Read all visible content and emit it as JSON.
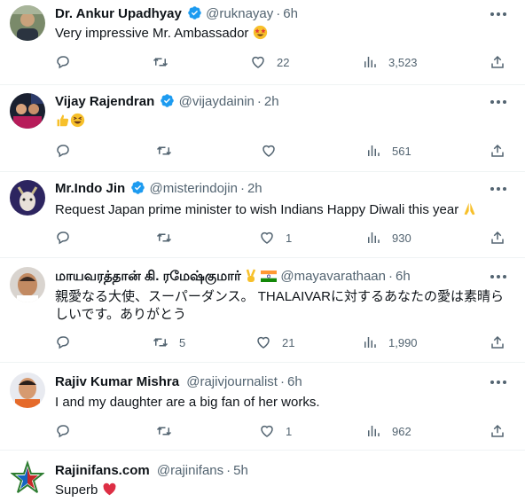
{
  "tweets": [
    {
      "name": "Dr. Ankur Upadhyay",
      "verified": true,
      "handle": "@ruknayay",
      "time": "6h",
      "text": "Very impressive Mr. Ambassador",
      "text_emoji": "star-struck",
      "replies": "",
      "retweets": "",
      "likes": "22",
      "views": "3,523"
    },
    {
      "name": "Vijay Rajendran",
      "verified": true,
      "handle": "@vijaydainin",
      "time": "2h",
      "text": "",
      "text_emoji": "thumbs-up-grinning",
      "replies": "",
      "retweets": "",
      "likes": "",
      "views": "561"
    },
    {
      "name": "Mr.Indo Jin",
      "verified": true,
      "handle": "@misterindojin",
      "time": "2h",
      "text": "Request Japan prime minister to wish Indians Happy Diwali this year",
      "text_emoji": "folded-hands",
      "replies": "",
      "retweets": "",
      "likes": "1",
      "views": "930"
    },
    {
      "name": "மாயவரத்தான் கி. ரமேஷ்குமார்",
      "verified": false,
      "handle": "@mayavarathaan",
      "time": "6h",
      "text": "親愛なる大使、スーパーダンス。 THALAIVARに対するあなたの愛は素晴らしいです。ありがとう",
      "text_emoji": "",
      "replies": "",
      "retweets": "5",
      "likes": "21",
      "views": "1,990"
    },
    {
      "name": "Rajiv Kumar Mishra",
      "verified": false,
      "handle": "@rajivjournalist",
      "time": "6h",
      "text": "I and my daughter are a big fan of her works.",
      "text_emoji": "",
      "replies": "",
      "retweets": "",
      "likes": "1",
      "views": "962"
    },
    {
      "name": "Rajinifans.com",
      "verified": false,
      "handle": "@rajinifans",
      "time": "5h",
      "text": "Superb",
      "text_emoji": "red-heart",
      "replies": "",
      "retweets": "",
      "likes": "",
      "views": ""
    }
  ],
  "colors": {
    "verified": "#1d9bf0",
    "text": "#0f1419",
    "muted": "#536471",
    "divider": "#eff3f4"
  }
}
